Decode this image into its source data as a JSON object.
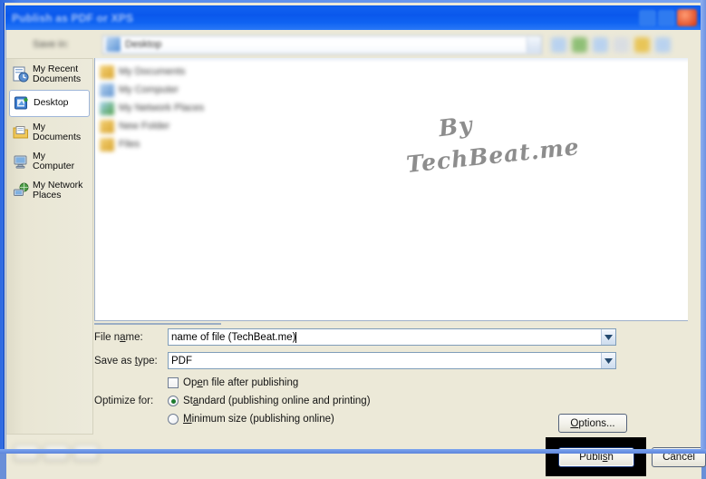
{
  "window": {
    "title": "Publish as PDF or XPS",
    "close_icon": "close-icon",
    "minimize_icon": "minimize-icon"
  },
  "toolbar": {
    "save_in_label": "Save in:",
    "save_in_value": "Desktop",
    "icons": [
      "back-icon",
      "up-one-level-icon",
      "search-web-icon",
      "delete-icon",
      "new-folder-icon",
      "views-icon"
    ]
  },
  "places_bar": {
    "items": [
      {
        "label": "My Recent Documents",
        "icon": "recent-documents-icon",
        "selected": false
      },
      {
        "label": "Desktop",
        "icon": "desktop-icon",
        "selected": true
      },
      {
        "label": "My Documents",
        "icon": "my-documents-icon",
        "selected": false
      },
      {
        "label": "My Computer",
        "icon": "my-computer-icon",
        "selected": false
      },
      {
        "label": "My Network Places",
        "icon": "my-network-places-icon",
        "selected": false
      }
    ]
  },
  "file_list": {
    "items": [
      {
        "name": "My Documents",
        "icon": "folder-icon"
      },
      {
        "name": "My Computer",
        "icon": "computer-icon"
      },
      {
        "name": "My Network Places",
        "icon": "network-icon"
      },
      {
        "name": "New Folder",
        "icon": "folder-icon"
      },
      {
        "name": "Files",
        "icon": "folder-icon"
      }
    ]
  },
  "watermark": {
    "line1": "By",
    "line2": "TechBeat.me"
  },
  "form": {
    "file_name_label": "File name:",
    "file_name_value": "name of file (TechBeat.me)",
    "save_as_type_label": "Save as type:",
    "save_as_type_value": "PDF",
    "open_after_publishing_label": "Open file after publishing",
    "open_after_publishing_checked": false,
    "optimize_for_label": "Optimize for:",
    "optimize_standard_label": "Standard (publishing online and printing)",
    "optimize_standard_selected": true,
    "optimize_minimum_label": "Minimum size (publishing online)",
    "optimize_minimum_selected": false,
    "options_button_label": "Options..."
  },
  "footer": {
    "publish_label": "Publish",
    "cancel_label": "Cancel",
    "highlight_color": "#000000"
  },
  "colors": {
    "titlebar_blue": "#0a58ec",
    "dialog_face": "#ece9d8",
    "radio_dot_green": "#1d7a2e",
    "watermark_gray": "#8d8d8d"
  }
}
